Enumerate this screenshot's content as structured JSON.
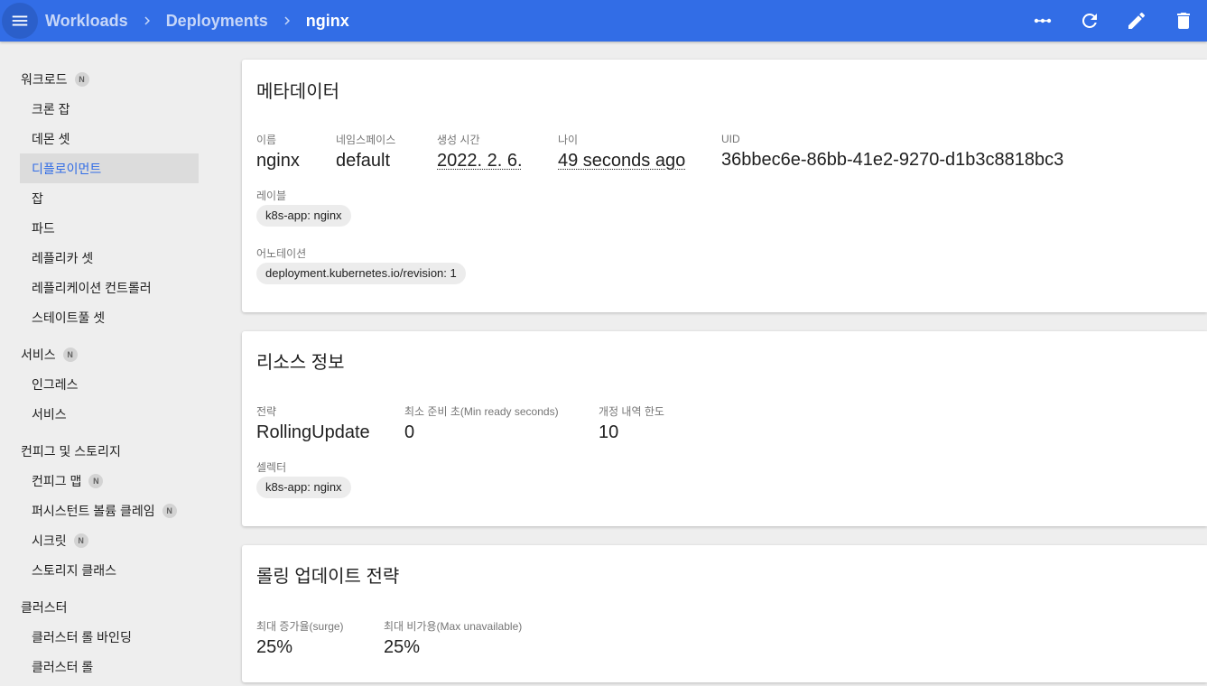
{
  "breadcrumb": {
    "items": [
      "Workloads",
      "Deployments"
    ],
    "current": "nginx"
  },
  "actions": {
    "icons": [
      "more-horiz-icon",
      "refresh-icon",
      "edit-icon",
      "delete-icon"
    ]
  },
  "colors": {
    "primary": "#326de6",
    "background": "#eeeeee"
  },
  "sidebar": {
    "workloads": {
      "label": "워크로드",
      "badge": "N"
    },
    "cron_jobs": "크론 잡",
    "daemon_sets": "데몬 셋",
    "deployments": "디플로이먼트",
    "jobs": "잡",
    "pods": "파드",
    "replica_sets": "레플리카 셋",
    "replication_controllers": "레플리케이션 컨트롤러",
    "stateful_sets": "스테이트풀 셋",
    "services": {
      "label": "서비스",
      "badge": "N"
    },
    "ingresses": "인그레스",
    "services_item": "서비스",
    "config_storage": "컨피그 및 스토리지",
    "config_maps": {
      "label": "컨피그 맵",
      "badge": "N"
    },
    "pvc": {
      "label": "퍼시스턴트 볼륨 클레임",
      "badge": "N"
    },
    "secrets": {
      "label": "시크릿",
      "badge": "N"
    },
    "storage_classes": "스토리지 클래스",
    "cluster": "클러스터",
    "cluster_role_bindings": "클러스터 롤 바인딩",
    "cluster_roles": "클러스터 롤"
  },
  "metadata": {
    "title": "메타데이터",
    "name": {
      "label": "이름",
      "value": "nginx"
    },
    "namespace": {
      "label": "네임스페이스",
      "value": "default"
    },
    "created": {
      "label": "생성 시간",
      "value": "2022. 2. 6."
    },
    "age": {
      "label": "나이",
      "value": "49 seconds ago"
    },
    "uid": {
      "label": "UID",
      "value": "36bbec6e-86bb-41e2-9270-d1b3c8818bc3"
    },
    "labels": {
      "label": "레이블",
      "chip": "k8s-app: nginx"
    },
    "annotations": {
      "label": "어노테이션",
      "chip": "deployment.kubernetes.io/revision: 1"
    }
  },
  "resource": {
    "title": "리소스 정보",
    "strategy": {
      "label": "전략",
      "value": "RollingUpdate"
    },
    "min_ready": {
      "label": "최소 준비 초(Min ready seconds)",
      "value": "0"
    },
    "revision_limit": {
      "label": "개정 내역 한도",
      "value": "10"
    },
    "selector": {
      "label": "셀렉터",
      "chip": "k8s-app: nginx"
    }
  },
  "rolling": {
    "title": "롤링 업데이트 전략",
    "max_surge": {
      "label": "최대 증가율(surge)",
      "value": "25%"
    },
    "max_unavailable": {
      "label": "최대 비가용(Max unavailable)",
      "value": "25%"
    }
  }
}
